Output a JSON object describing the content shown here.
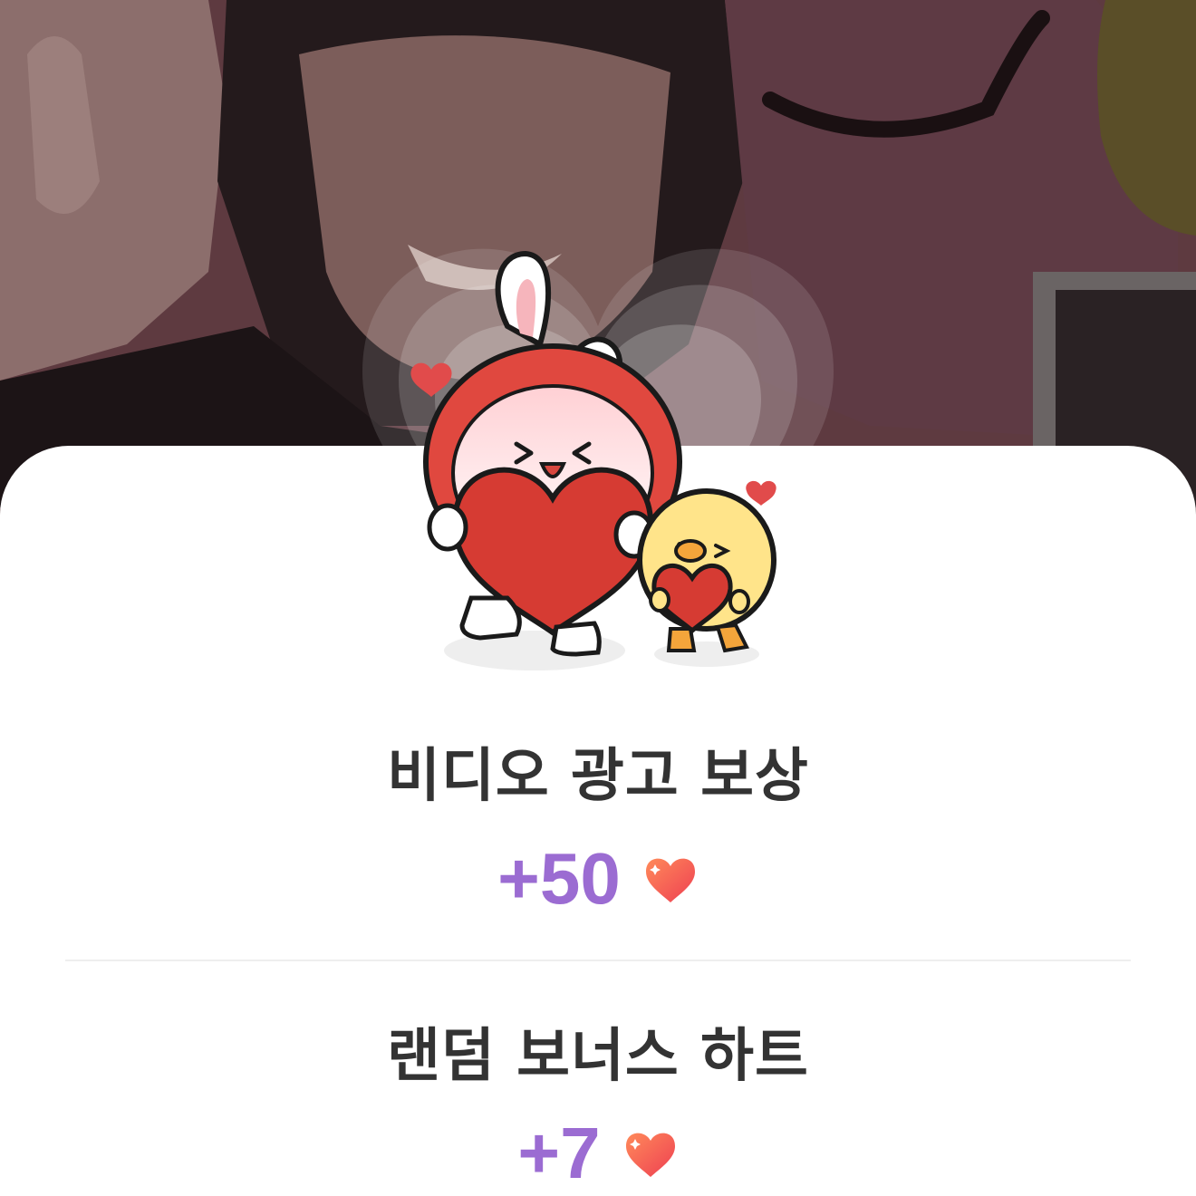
{
  "rewards": [
    {
      "title": "비디오 광고 보상",
      "amount": "+50",
      "icon": "heart-icon"
    },
    {
      "title": "랜덤 보너스 하트",
      "amount": "+7",
      "icon": "heart-icon"
    }
  ],
  "colors": {
    "amount": "#9b6cd2",
    "title": "#333333",
    "heart": "#f0524a"
  }
}
